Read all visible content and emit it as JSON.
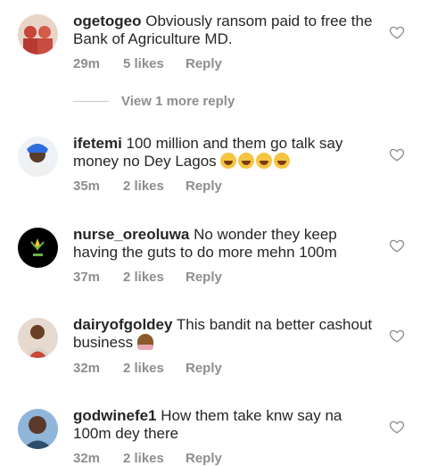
{
  "comments": [
    {
      "username": "ogetogeo",
      "text": " Obviously ransom paid to free the Bank of Agriculture MD.",
      "time": "29m",
      "likes": "5 likes",
      "reply": "Reply",
      "avatar_color": "#d98a8a"
    },
    {
      "username": "ifetemi",
      "text": " 100 million and them go talk say money no Dey Lagos ",
      "time": "35m",
      "likes": "2 likes",
      "reply": "Reply",
      "avatar_color": "#3a6fd8"
    },
    {
      "username": "nurse_oreoluwa",
      "text": " No wonder they keep having the guts to do more  mehn 100m",
      "time": "37m",
      "likes": "2 likes",
      "reply": "Reply",
      "avatar_color": "#000000"
    },
    {
      "username": "dairyofgoldey",
      "text": " This bandit na better cashout business ",
      "time": "32m",
      "likes": "2 likes",
      "reply": "Reply",
      "avatar_color": "#9e6b4a"
    },
    {
      "username": "godwinefe1",
      "text": " How them take knw say na 100m dey there",
      "time": "32m",
      "likes": "2 likes",
      "reply": "Reply",
      "avatar_color": "#6b4a3a"
    }
  ],
  "view_more": "View 1 more reply",
  "icons": {
    "heart": "heart-outline-icon",
    "emoji_laugh": "tears-of-joy-emoji",
    "emoji_facepalm": "woman-facepalming-emoji"
  },
  "colors": {
    "text": "#262626",
    "meta": "#8e8e8e",
    "divider": "#c7c7c7"
  }
}
